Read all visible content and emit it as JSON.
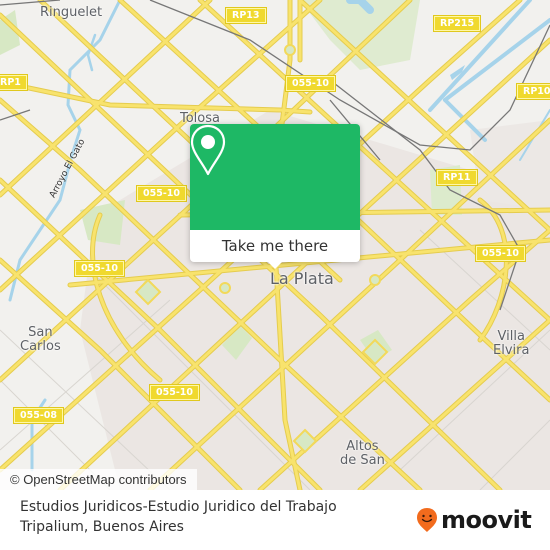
{
  "map": {
    "places": [
      {
        "name": "Ringuelet",
        "style": "normal"
      },
      {
        "name": "Tolosa",
        "style": "normal"
      },
      {
        "name": "La Plata",
        "style": "big"
      },
      {
        "name": "San\nCarlos",
        "style": "normal"
      },
      {
        "name": "Villa\nElvira",
        "style": "normal"
      },
      {
        "name": "Altos\nde San",
        "style": "normal"
      }
    ],
    "street_labels": [
      "Arroyo El Gato"
    ],
    "road_shields": [
      "RP13",
      "RP215",
      "RP1",
      "055-10",
      "RP10",
      "RP11",
      "055-10",
      "055-10",
      "055-10",
      "055-10",
      "055-08"
    ],
    "colors": {
      "background": "#f2f1ee",
      "urban": "#e9e4e1",
      "road": "#f7df64",
      "road_casing": "#e8cf52",
      "water": "#a6d3ea",
      "park": "#d7e8c4",
      "rail": "#777777",
      "shield": "#f0d92e"
    }
  },
  "popup": {
    "icon": "map-pin-icon",
    "button_label": "Take me there",
    "color": "#1eb865"
  },
  "attribution": "© OpenStreetMap contributors",
  "footer": {
    "title": "Estudios Juridicos-Estudio Juridico del Trabajo Tripalium, Buenos Aires",
    "logo_text": "moovit",
    "logo_icon": "moovit-pin-face-icon",
    "logo_color": "#f26b1d"
  }
}
